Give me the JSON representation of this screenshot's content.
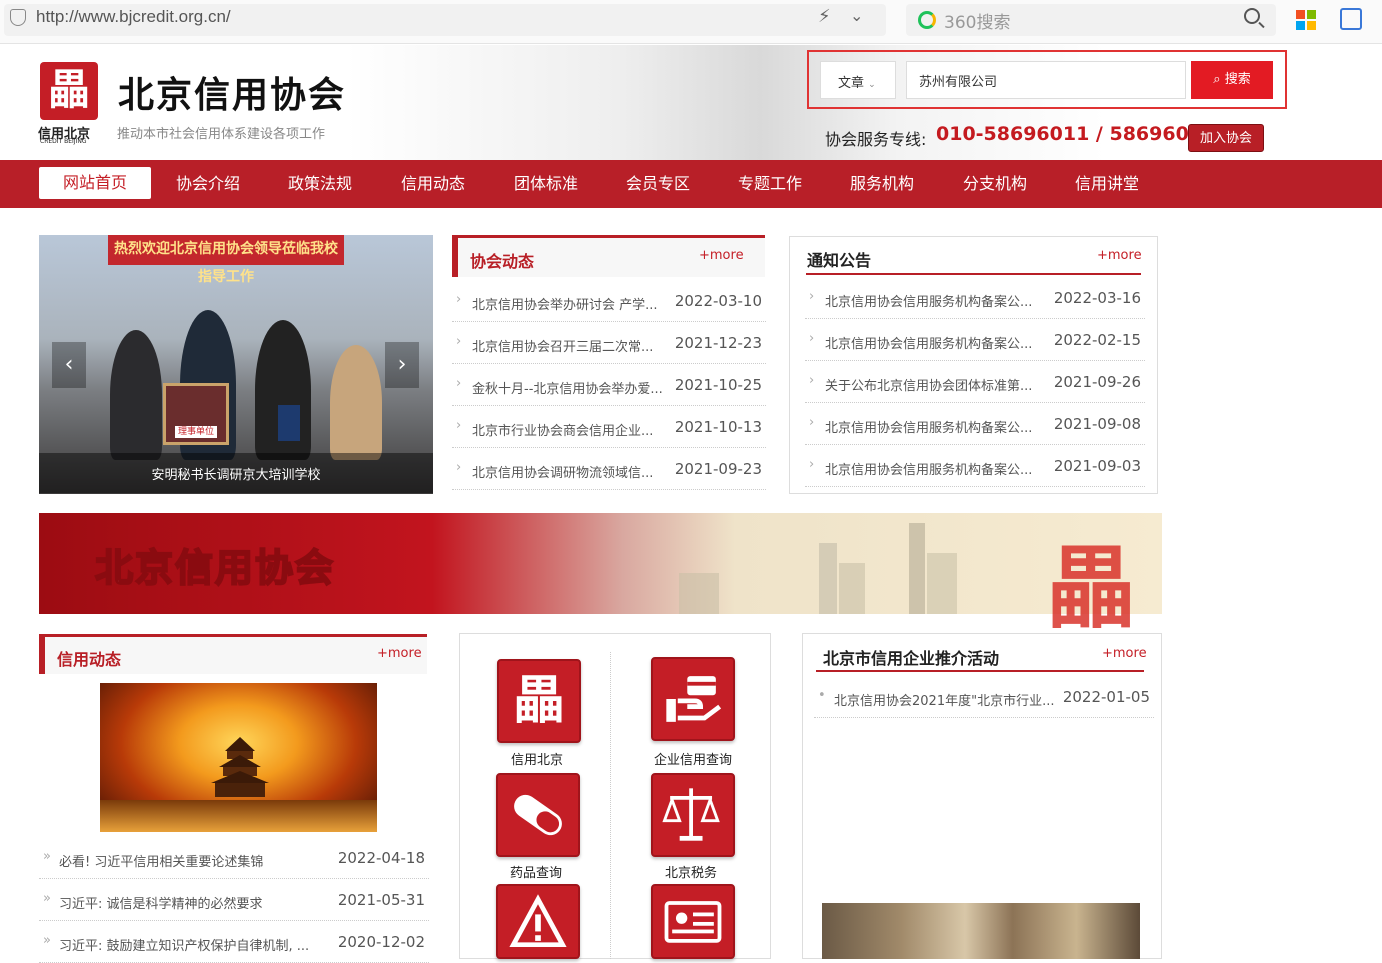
{
  "browser": {
    "url": "http://www.bjcredit.org.cn/",
    "search_placeholder": "360搜索"
  },
  "header": {
    "logo_glyph": "畾",
    "logo_sub": "信用北京",
    "logo_tiny": "CREDIT BEIJING",
    "title": "北京信用协会",
    "slogan": "推动本市社会信用体系建设各项工作",
    "search_type": "文章",
    "search_value": "苏州有限公司",
    "search_button": "搜索",
    "hotline_label": "协会服务专线:",
    "hotline": "010-58696011 / 58696012",
    "join_button": "加入协会"
  },
  "nav": [
    "网站首页",
    "协会介绍",
    "政策法规",
    "信用动态",
    "团体标准",
    "会员专区",
    "专题工作",
    "服务机构",
    "分支机构",
    "信用讲堂"
  ],
  "slideshow": {
    "banner": "热烈欢迎北京信用协会领导莅临我校指导工作",
    "caption": "安明秘书长调研京大培训学校",
    "plaque": "理事单位"
  },
  "association_news": {
    "title": "协会动态",
    "more": "+more",
    "items": [
      {
        "title": "北京信用协会举办研讨会 产学...",
        "date": "2022-03-10"
      },
      {
        "title": "北京信用协会召开三届二次常...",
        "date": "2021-12-23"
      },
      {
        "title": "金秋十月--北京信用协会举办爱...",
        "date": "2021-10-25"
      },
      {
        "title": "北京市行业协会商会信用企业...",
        "date": "2021-10-13"
      },
      {
        "title": "北京信用协会调研物流领域信...",
        "date": "2021-09-23"
      }
    ]
  },
  "notices": {
    "title": "通知公告",
    "more": "+more",
    "items": [
      {
        "title": "北京信用协会信用服务机构备案公...",
        "date": "2022-03-16"
      },
      {
        "title": "北京信用协会信用服务机构备案公...",
        "date": "2022-02-15"
      },
      {
        "title": "关于公布北京信用协会团体标准第...",
        "date": "2021-09-26"
      },
      {
        "title": "北京信用协会信用服务机构备案公...",
        "date": "2021-09-08"
      },
      {
        "title": "北京信用协会信用服务机构备案公...",
        "date": "2021-09-03"
      }
    ]
  },
  "banner": {
    "text": "北京信用协会"
  },
  "credit_news": {
    "title": "信用动态",
    "more": "+more",
    "items": [
      {
        "title": "必看! 习近平信用相关重要论述集锦",
        "date": "2022-04-18"
      },
      {
        "title": "习近平: 诚信是科学精神的必然要求",
        "date": "2021-05-31"
      },
      {
        "title": "习近平: 鼓励建立知识产权保护自律机制, ...",
        "date": "2020-12-02"
      }
    ]
  },
  "quick_links": [
    {
      "label": "信用北京",
      "icon": "credit-beijing-icon"
    },
    {
      "label": "企业信用查询",
      "icon": "hand-card-icon"
    },
    {
      "label": "药品查询",
      "icon": "pill-icon"
    },
    {
      "label": "北京税务",
      "icon": "scale-icon"
    },
    {
      "label": "",
      "icon": "warning-icon"
    },
    {
      "label": "",
      "icon": "id-card-icon"
    }
  ],
  "recommend": {
    "title": "北京市信用企业推介活动",
    "more": "+more",
    "items": [
      {
        "title": "北京信用协会2021年度\"北京市行业...",
        "date": "2022-01-05"
      }
    ]
  },
  "colors": {
    "brand_red": "#b81f26",
    "search_red": "#e31b23"
  }
}
